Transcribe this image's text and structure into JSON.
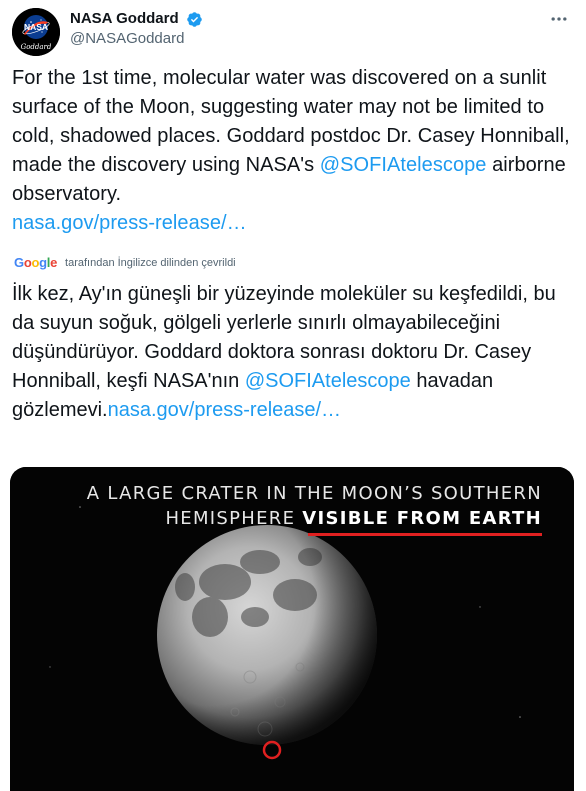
{
  "author": {
    "name": "NASA Goddard",
    "handle": "@NASAGoddard",
    "avatar_text": "NASA",
    "avatar_sub": "Goddard"
  },
  "icons": {
    "verified": "verified-badge-icon",
    "more": "more-options-icon"
  },
  "tweet": {
    "text_part1": "For the 1st time, molecular water was discovered on a sunlit surface of the Moon, suggesting water may not be limited to cold, shadowed places. Goddard postdoc Dr. Casey Honniball, made the discovery using NASA's ",
    "mention": "@SOFIAtelescope",
    "text_part2": " airborne observatory.",
    "link": "nasa.gov/press-release/…"
  },
  "translation": {
    "provider": "Google",
    "note": "tarafından İngilizce dilinden çevrildi",
    "text_part1": "İlk kez, Ay'ın güneşli bir yüzeyinde moleküler su keşfedildi, bu da suyun soğuk, gölgeli yerlerle sınırlı olmayabileceğini düşündürüyor. Goddard doktora sonrası doktoru Dr. Casey Honniball, keşfi NASA'nın ",
    "mention": "@SOFIAtelescope",
    "text_part2": " havadan gözlemevi.",
    "link": "nasa.gov/press-release/…"
  },
  "media": {
    "caption_line1": "A LARGE CRATER IN THE MOON’S SOUTHERN",
    "caption_line2_plain": "HEMISPHERE ",
    "caption_line2_highlight": "VISIBLE FROM EARTH"
  },
  "colors": {
    "link": "#1d9bf0",
    "verified": "#1d9bf0",
    "highlight_red": "#e02020"
  }
}
